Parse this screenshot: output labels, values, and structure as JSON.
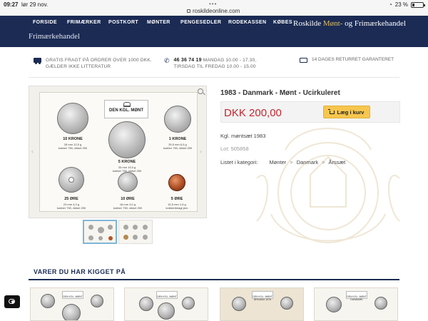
{
  "statusbar": {
    "time": "09:27",
    "date": "lør 29 nov.",
    "dots": "•••",
    "url": "roskildeonline.com",
    "battery_text": "23 %",
    "battery_level": 0.23
  },
  "nav": {
    "items": [
      "FORSIDE",
      "FRIMÆRKER",
      "POSTKORT",
      "MØNTER",
      "PENGESEDLER",
      "RODEKASSEN",
      "KØBES"
    ],
    "brand_prefix": "Roskilde ",
    "brand_highlight": "Mønt-",
    "brand_suffix": " og Frimærkehandel",
    "sub_brand": "Frimærkehandel"
  },
  "infobar": {
    "shipping": "GRATIS FRAGT PÅ ORDRER OVER 1000 DKK. GÆLDER IKKE LITTERATUR",
    "phone_number": "46 36 74 19",
    "phone_hours_1": " MANDAG 10.00 - 17.30,",
    "phone_hours_2": "TIRSDAG TIL FREDAG 10.00 - 15.00",
    "returns": "14 DAGES RETURRET GARANTERET"
  },
  "product": {
    "title": "1983 - Danmark - Mønt - Ucirkuleret",
    "price": "DKK 200,00",
    "add_to_cart": "Læg i kurv",
    "description": "Kgl. møntsæt 1983",
    "lot": "Lot: 505858",
    "category_label": "Listet i kategori:",
    "category_path": [
      "Mønter",
      "Danmark",
      "Årssæt"
    ],
    "category_separator": ">"
  },
  "coin_card": {
    "title": "DEN KGL. MØNT",
    "coins": [
      {
        "label": "10 KRONE",
        "spec1": "28 mm   12,5 g",
        "spec2": "kobber 750, nikkel 250"
      },
      {
        "label": "5 KRONE",
        "spec1": "33 mm   15,5 g",
        "spec2": "kobber 750, nikkel 250"
      },
      {
        "label": "1 KRONE",
        "spec1": "25,5 mm   6,5 g",
        "spec2": "kobber 750, nikkel 250"
      },
      {
        "label": "25 ØRE",
        "spec1": "23 mm   4,3 g",
        "spec2": "kobber 750, nikkel 250"
      },
      {
        "label": "10 ØRE",
        "spec1": "18 mm   3,0 g",
        "spec2": "kobber 750, nikkel 250"
      },
      {
        "label": "5 ØRE",
        "spec1": "15,5 mm   1,6 g",
        "spec2": "kobberbelagt jern"
      }
    ]
  },
  "recently_viewed": {
    "heading": "VARER DU HAR KIGGET PÅ",
    "cards": [
      {
        "tag": "DEN KGL. MØNT"
      },
      {
        "tag": "DEN KGL. MØNT"
      },
      {
        "tag": "DEN KGL. MØNT ÅRGANG 1976"
      },
      {
        "tag": "DEN KGL. MØNT DANMARK"
      }
    ]
  },
  "icons": {
    "truck": "truck-icon",
    "phone": "phone-icon",
    "money": "money-icon",
    "cart": "cart-icon",
    "zoom": "zoom-icon",
    "lock": "lock-icon",
    "wifi": "wifi-icon",
    "battery": "battery-icon"
  },
  "colors": {
    "navy": "#1b2b54",
    "gold": "#e0bf61",
    "price_red": "#c4262e",
    "cart_yellow": "#f6c64e"
  }
}
